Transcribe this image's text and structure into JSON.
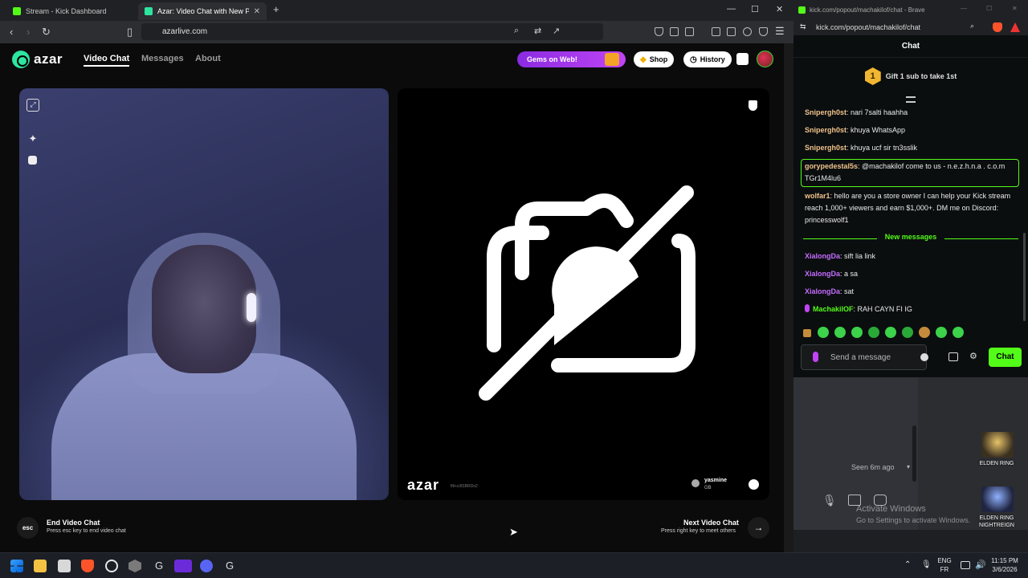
{
  "left_browser": {
    "tabs": [
      {
        "label": "Stream - Kick Dashboard",
        "favicon_color": "#53fc18"
      },
      {
        "label": "Azar: Video Chat with New Pe",
        "favicon_color": "#2ee5a0"
      }
    ],
    "new_tab": "+",
    "window_controls": {
      "min": "—",
      "max": "☐",
      "close": "✕"
    },
    "url": "azarlive.com"
  },
  "azar": {
    "logo": "azar",
    "nav": {
      "video_chat": "Video Chat",
      "messages": "Messages",
      "about": "About"
    },
    "gems_banner": "Gems on Web!",
    "shop_label": "Shop",
    "history_label": "History",
    "peer": {
      "logo": "azar",
      "id": "fltl+z3lSBRDo2",
      "name": "yasmine",
      "country": "GB"
    },
    "footer": {
      "esc_key": "esc",
      "end_title": "End Video Chat",
      "end_sub": "Press esc key to end video chat",
      "next_title": "Next Video Chat",
      "next_sub": "Press right key to meet others"
    }
  },
  "kick_chat": {
    "title_url": "kick.com/popout/machakilof/chat - Brave",
    "url": "kick.com/popout/machakilof/chat",
    "header": "Chat",
    "gift": {
      "rank": "1",
      "text": "Gift 1 sub to take 1st"
    },
    "messages": [
      {
        "user": "Snipergh0st",
        "text": "nari 7salti haahha",
        "color": "#f0c38c"
      },
      {
        "user": "Snipergh0st",
        "text": "khuya WhatsApp",
        "color": "#f0c38c"
      },
      {
        "user": "Snipergh0st",
        "text": "khuya ucf sir tn3sslik",
        "color": "#f0c38c"
      },
      {
        "user": "gorypedestal5s",
        "text": "@machakilof come to us - n.e.z.h.n.a . c.o.m TGr1M4lu6",
        "color": "#f0c38c"
      },
      {
        "user": "wolfar1",
        "text": "hello are you a store owner I can help your Kick stream reach 1,000+ viewers and earn $1,000+. DM me on Discord: princesswolf1",
        "color": "#f0c38c"
      }
    ],
    "new_messages_label": "New messages",
    "new_messages": [
      {
        "user": "XialongDa",
        "text": "sift lia link",
        "color": "#c46cff"
      },
      {
        "user": "XialongDa",
        "text": "a sa",
        "color": "#c46cff"
      },
      {
        "user": "XialongDa",
        "text": "sat",
        "color": "#c46cff"
      },
      {
        "user": "MachakilOF",
        "text": "RAH CAYN FI IG",
        "color": "#53fc18"
      }
    ],
    "input_placeholder": "Send a message",
    "chat_button": "Chat"
  },
  "underlying_app": {
    "seen": "Seen 6m ago"
  },
  "desktop": {
    "icons": [
      {
        "label": "ELDEN RING"
      },
      {
        "label": "ELDEN RING NIGHTREIGN"
      }
    ],
    "watermark_title": "Activate Windows",
    "watermark_sub": "Go to Settings to activate Windows."
  },
  "taskbar": {
    "lang_top": "ENG",
    "lang_bottom": "FR",
    "time": "11:15 PM",
    "date": "3/6/2026"
  }
}
